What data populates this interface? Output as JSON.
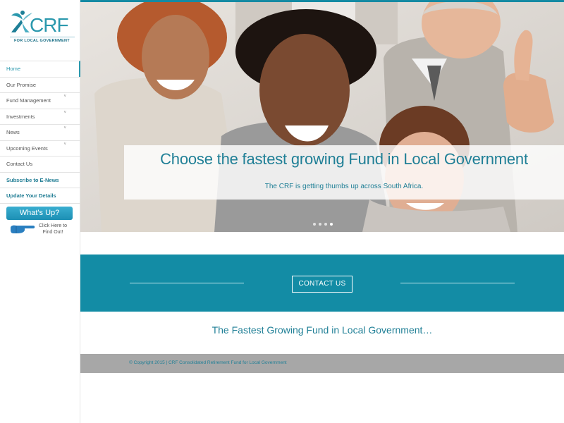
{
  "brand": {
    "name": "CRF",
    "tagline": "FOR LOCAL GOVERNMENT",
    "accent_color": "#138ca5",
    "icon": "person-leaf-icon"
  },
  "sidebar": {
    "items": [
      {
        "label": "Home",
        "active": true,
        "has_submenu": false
      },
      {
        "label": "Our Promise",
        "has_submenu": false
      },
      {
        "label": "Fund Management",
        "has_submenu": true
      },
      {
        "label": "Investments",
        "has_submenu": true
      },
      {
        "label": "News",
        "has_submenu": true
      },
      {
        "label": "Upcoming Events",
        "has_submenu": true
      },
      {
        "label": "Contact Us",
        "has_submenu": false
      },
      {
        "label": "Subscribe to E-News",
        "bold": true
      },
      {
        "label": "Update Your Details",
        "bold": true
      }
    ],
    "whats_up_label": "What's Up?",
    "click_here_line1": "Click Here to",
    "click_here_line2": "Find Out!",
    "click_icon": "pointing-hand-icon"
  },
  "hero": {
    "title": "Choose the fastest growing Fund in Local Government",
    "subtitle": "The CRF is getting thumbs up across South Africa.",
    "slides": 4,
    "active_slide": 4
  },
  "contact_band": {
    "button_label": "CONTACT US"
  },
  "tagline": "The Fastest Growing Fund in Local Government…",
  "footer": {
    "copyright": "© Copyright 2015 | CRF Consolidated Retirement Fund for Local Government"
  }
}
